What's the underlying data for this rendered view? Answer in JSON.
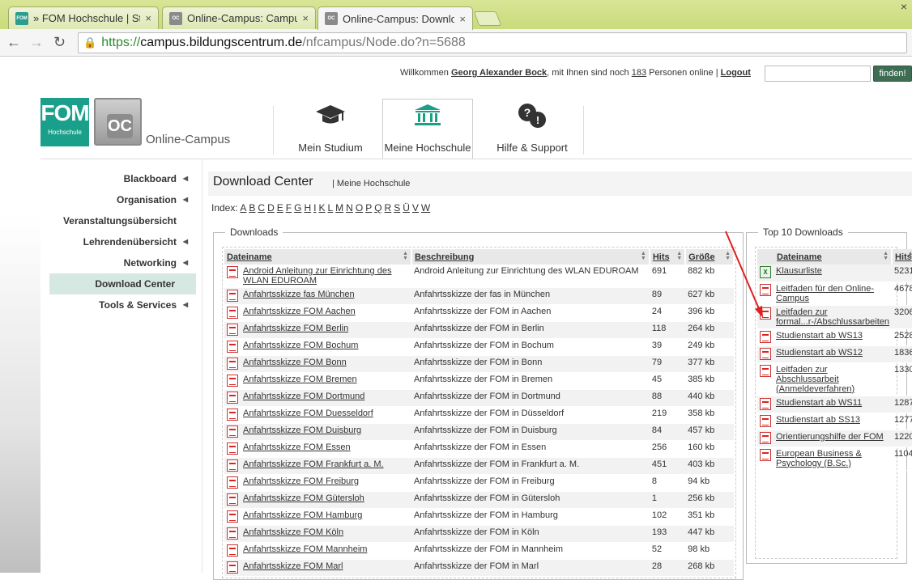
{
  "browser": {
    "tabs": [
      {
        "title": "» FOM Hochschule | Studi",
        "icon": "fom-favicon"
      },
      {
        "title": "Online-Campus: Campus",
        "icon": "oc-favicon"
      },
      {
        "title": "Online-Campus: Downloa",
        "icon": "oc-favicon"
      }
    ],
    "close_glyph": "×",
    "url_https": "https://",
    "url_host": "campus.bildungscentrum.de",
    "url_path": "/nfcampus/Node.do?n=5688"
  },
  "topbar": {
    "welcome_prefix": "Willkommen",
    "user_name": "Georg Alexander Bock",
    "mid_text": ", mit Ihnen sind noch",
    "online_count": "183",
    "suffix_text": "Personen online |",
    "logout": "Logout",
    "search_button": "finden!"
  },
  "logo": {
    "fom_big": "FOM",
    "fom_small": "Hochschule",
    "oc": "OC",
    "text": "Online-Campus"
  },
  "mainnav": [
    {
      "label": "Mein Studium",
      "icon": "graduation-cap-icon"
    },
    {
      "label": "Meine Hochschule",
      "icon": "institution-icon"
    },
    {
      "label": "Hilfe & Support",
      "icon": "help-bubbles-icon"
    }
  ],
  "sidemenu": [
    {
      "label": "Blackboard",
      "arrow": true
    },
    {
      "label": "Organisation",
      "arrow": true
    },
    {
      "label": "Veranstaltungsübersicht",
      "arrow": false
    },
    {
      "label": "Lehrendenübersicht",
      "arrow": true
    },
    {
      "label": "Networking",
      "arrow": true
    },
    {
      "label": "Download Center",
      "arrow": false
    },
    {
      "label": "Tools & Services",
      "arrow": true
    }
  ],
  "page": {
    "title": "Download Center",
    "breadcrumb": "| Meine Hochschule",
    "index_label": "Index:",
    "index_letters": [
      "A",
      "B",
      "C",
      "D",
      "E",
      "F",
      "G",
      "H",
      "I",
      "K",
      "L",
      "M",
      "N",
      "O",
      "P",
      "Q",
      "R",
      "S",
      "Ü",
      "V",
      "W"
    ]
  },
  "downloads": {
    "legend": "Downloads",
    "headers": {
      "name": "Dateiname",
      "desc": "Beschreibung",
      "hits": "Hits",
      "size": "Größe"
    },
    "rows": [
      {
        "name": "Android Anleitung zur Einrichtung des WLAN EDUROAM",
        "desc": "Android Anleitung zur Einrichtung des WLAN EDUROAM",
        "hits": "691",
        "size": "882 kb"
      },
      {
        "name": "Anfahrtsskizze fas München",
        "desc": "Anfahrtsskizze der fas in München",
        "hits": "89",
        "size": "627 kb"
      },
      {
        "name": "Anfahrtsskizze FOM Aachen",
        "desc": "Anfahrtsskizze der FOM in Aachen",
        "hits": "24",
        "size": "396 kb"
      },
      {
        "name": "Anfahrtsskizze FOM Berlin",
        "desc": "Anfahrtsskizze der FOM in Berlin",
        "hits": "118",
        "size": "264 kb"
      },
      {
        "name": "Anfahrtsskizze FOM Bochum",
        "desc": "Anfahrtsskizze der FOM in Bochum",
        "hits": "39",
        "size": "249 kb"
      },
      {
        "name": "Anfahrtsskizze FOM Bonn",
        "desc": "Anfahrtsskizze der FOM in Bonn",
        "hits": "79",
        "size": "377 kb"
      },
      {
        "name": "Anfahrtsskizze FOM Bremen",
        "desc": "Anfahrtsskizze der FOM in Bremen",
        "hits": "45",
        "size": "385 kb"
      },
      {
        "name": "Anfahrtsskizze FOM Dortmund",
        "desc": "Anfahrtsskizze der FOM in Dortmund",
        "hits": "88",
        "size": "440 kb"
      },
      {
        "name": "Anfahrtsskizze FOM Duesseldorf",
        "desc": "Anfahrtsskizze der FOM in Düsseldorf",
        "hits": "219",
        "size": "358 kb"
      },
      {
        "name": "Anfahrtsskizze FOM Duisburg",
        "desc": "Anfahrtsskizze der FOM in Duisburg",
        "hits": "84",
        "size": "457 kb"
      },
      {
        "name": "Anfahrtsskizze FOM Essen",
        "desc": "Anfahrtsskizze der FOM in Essen",
        "hits": "256",
        "size": "160 kb"
      },
      {
        "name": "Anfahrtsskizze FOM Frankfurt a. M.",
        "desc": "Anfahrtsskizze der FOM in Frankfurt a. M.",
        "hits": "451",
        "size": "403 kb"
      },
      {
        "name": "Anfahrtsskizze FOM Freiburg",
        "desc": "Anfahrtsskizze der FOM in Freiburg",
        "hits": "8",
        "size": "94 kb"
      },
      {
        "name": "Anfahrtsskizze FOM Gütersloh",
        "desc": "Anfahrtsskizze der FOM in Gütersloh",
        "hits": "1",
        "size": "256 kb"
      },
      {
        "name": "Anfahrtsskizze FOM Hamburg",
        "desc": "Anfahrtsskizze der FOM in Hamburg",
        "hits": "102",
        "size": "351 kb"
      },
      {
        "name": "Anfahrtsskizze FOM Köln",
        "desc": "Anfahrtsskizze der FOM in Köln",
        "hits": "193",
        "size": "447 kb"
      },
      {
        "name": "Anfahrtsskizze FOM Mannheim",
        "desc": "Anfahrtsskizze der FOM in Mannheim",
        "hits": "52",
        "size": "98 kb"
      },
      {
        "name": "Anfahrtsskizze FOM Marl",
        "desc": "Anfahrtsskizze der FOM in Marl",
        "hits": "28",
        "size": "268 kb"
      }
    ]
  },
  "top10": {
    "legend": "Top 10 Downloads",
    "headers": {
      "name": "Dateiname",
      "hits": "Hits"
    },
    "rows": [
      {
        "name": "Klausurliste",
        "hits": "5231",
        "type": "xls"
      },
      {
        "name": "Leitfaden für den Online-Campus",
        "hits": "4678",
        "type": "pdf"
      },
      {
        "name": "Leitfaden zur formal...r-/Abschlussarbeiten",
        "hits": "3206",
        "type": "pdf"
      },
      {
        "name": "Studienstart ab WS13",
        "hits": "2528",
        "type": "pdf"
      },
      {
        "name": "Studienstart ab WS12",
        "hits": "1836",
        "type": "pdf"
      },
      {
        "name": "Leitfaden zur Abschlussarbeit (Anmeldeverfahren)",
        "hits": "1330",
        "type": "pdf"
      },
      {
        "name": "Studienstart ab WS11",
        "hits": "1287",
        "type": "pdf"
      },
      {
        "name": "Studienstart ab SS13",
        "hits": "1277",
        "type": "pdf"
      },
      {
        "name": "Orientierungshilfe der FOM",
        "hits": "1220",
        "type": "pdf"
      },
      {
        "name": "European Business & Psychology (B.Sc.)",
        "hits": "1104",
        "type": "pdf"
      }
    ]
  },
  "colors": {
    "brand_teal": "#1aa08a",
    "annotation_arrow": "#e02020",
    "active_menu": "#d6e8e2"
  }
}
